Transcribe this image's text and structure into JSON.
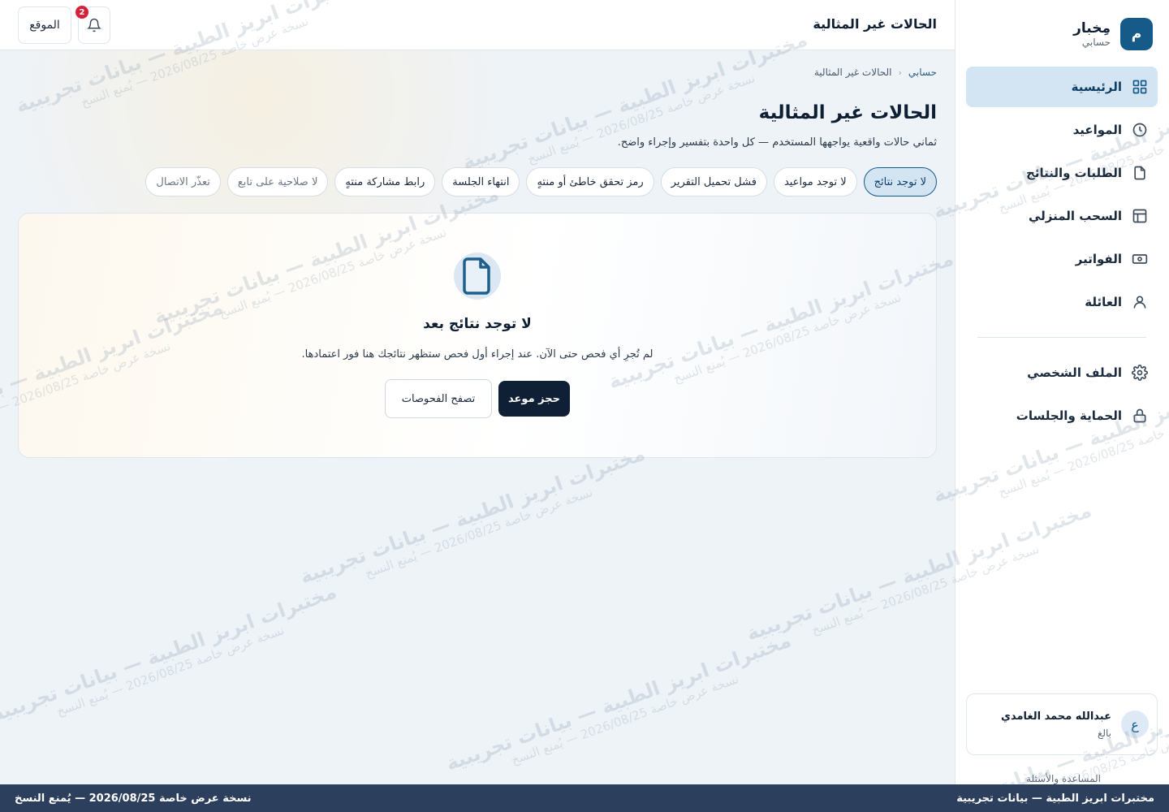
{
  "brand": {
    "logo_letter": "م",
    "name": "مِخبار",
    "subtitle": "حسابي"
  },
  "sidebar": {
    "items": [
      {
        "label": "الرئيسية",
        "icon": "grid-icon",
        "active": true
      },
      {
        "label": "المواعيد",
        "icon": "clock-icon"
      },
      {
        "label": "الطلبات والنتائج",
        "icon": "file-icon"
      },
      {
        "label": "السحب المنزلي",
        "icon": "layout-icon"
      },
      {
        "label": "الفواتير",
        "icon": "banknote-icon"
      },
      {
        "label": "العائلة",
        "icon": "user-icon"
      }
    ],
    "secondary_items": [
      {
        "label": "الملف الشخصي",
        "icon": "gear-icon"
      },
      {
        "label": "الحماية والجلسات",
        "icon": "lock-icon"
      }
    ],
    "user": {
      "initial": "ع",
      "name": "عبدالله محمد الغامدي",
      "role": "بالغ"
    },
    "help_label": "المساعدة والأسئلة"
  },
  "header": {
    "title": "الحالات غير المثالية",
    "site_button": "الموقع",
    "notification_count": "2"
  },
  "breadcrumb": {
    "root": "حسابي",
    "current": "الحالات غير المثالية"
  },
  "page": {
    "title": "الحالات غير المثالية",
    "subtitle": "ثماني حالات واقعية يواجهها المستخدم — كل واحدة بتفسير وإجراء واضح."
  },
  "chips": [
    {
      "label": "لا توجد نتائج",
      "active": true
    },
    {
      "label": "لا توجد مواعيد"
    },
    {
      "label": "فشل تحميل التقرير"
    },
    {
      "label": "رمز تحقق خاطئ أو منتهٍ"
    },
    {
      "label": "انتهاء الجلسة"
    },
    {
      "label": "رابط مشاركة منتهٍ"
    },
    {
      "label": "لا صلاحية على تابع",
      "faded": true
    },
    {
      "label": "تعذّر الاتصال",
      "faded": true
    }
  ],
  "empty_state": {
    "icon": "document-icon",
    "title": "لا توجد نتائج بعد",
    "description": "لم تُجرِ أي فحص حتى الآن. عند إجراء أول فحص ستظهر نتائجك هنا فور اعتمادها.",
    "primary_button": "حجز موعد",
    "secondary_button": "تصفح الفحوصات"
  },
  "watermark": {
    "line1": "مختبرات ابريز الطبية — بيانات تجريبية",
    "line2": "نسخة عرض خاصة 2026/08/25 — يُمنع النسخ"
  },
  "footer": {
    "right_text": "مختبرات ابريز الطبية — بيانات تجريبية",
    "left_text": "نسخة عرض خاصة 2026/08/25 — يُمنع النسخ"
  },
  "colors": {
    "accent": "#165a8a",
    "active_bg": "#d3e5f3",
    "primary_button": "#0f1f36",
    "badge": "#d5203a",
    "footer_bg": "#2c3f5c"
  }
}
